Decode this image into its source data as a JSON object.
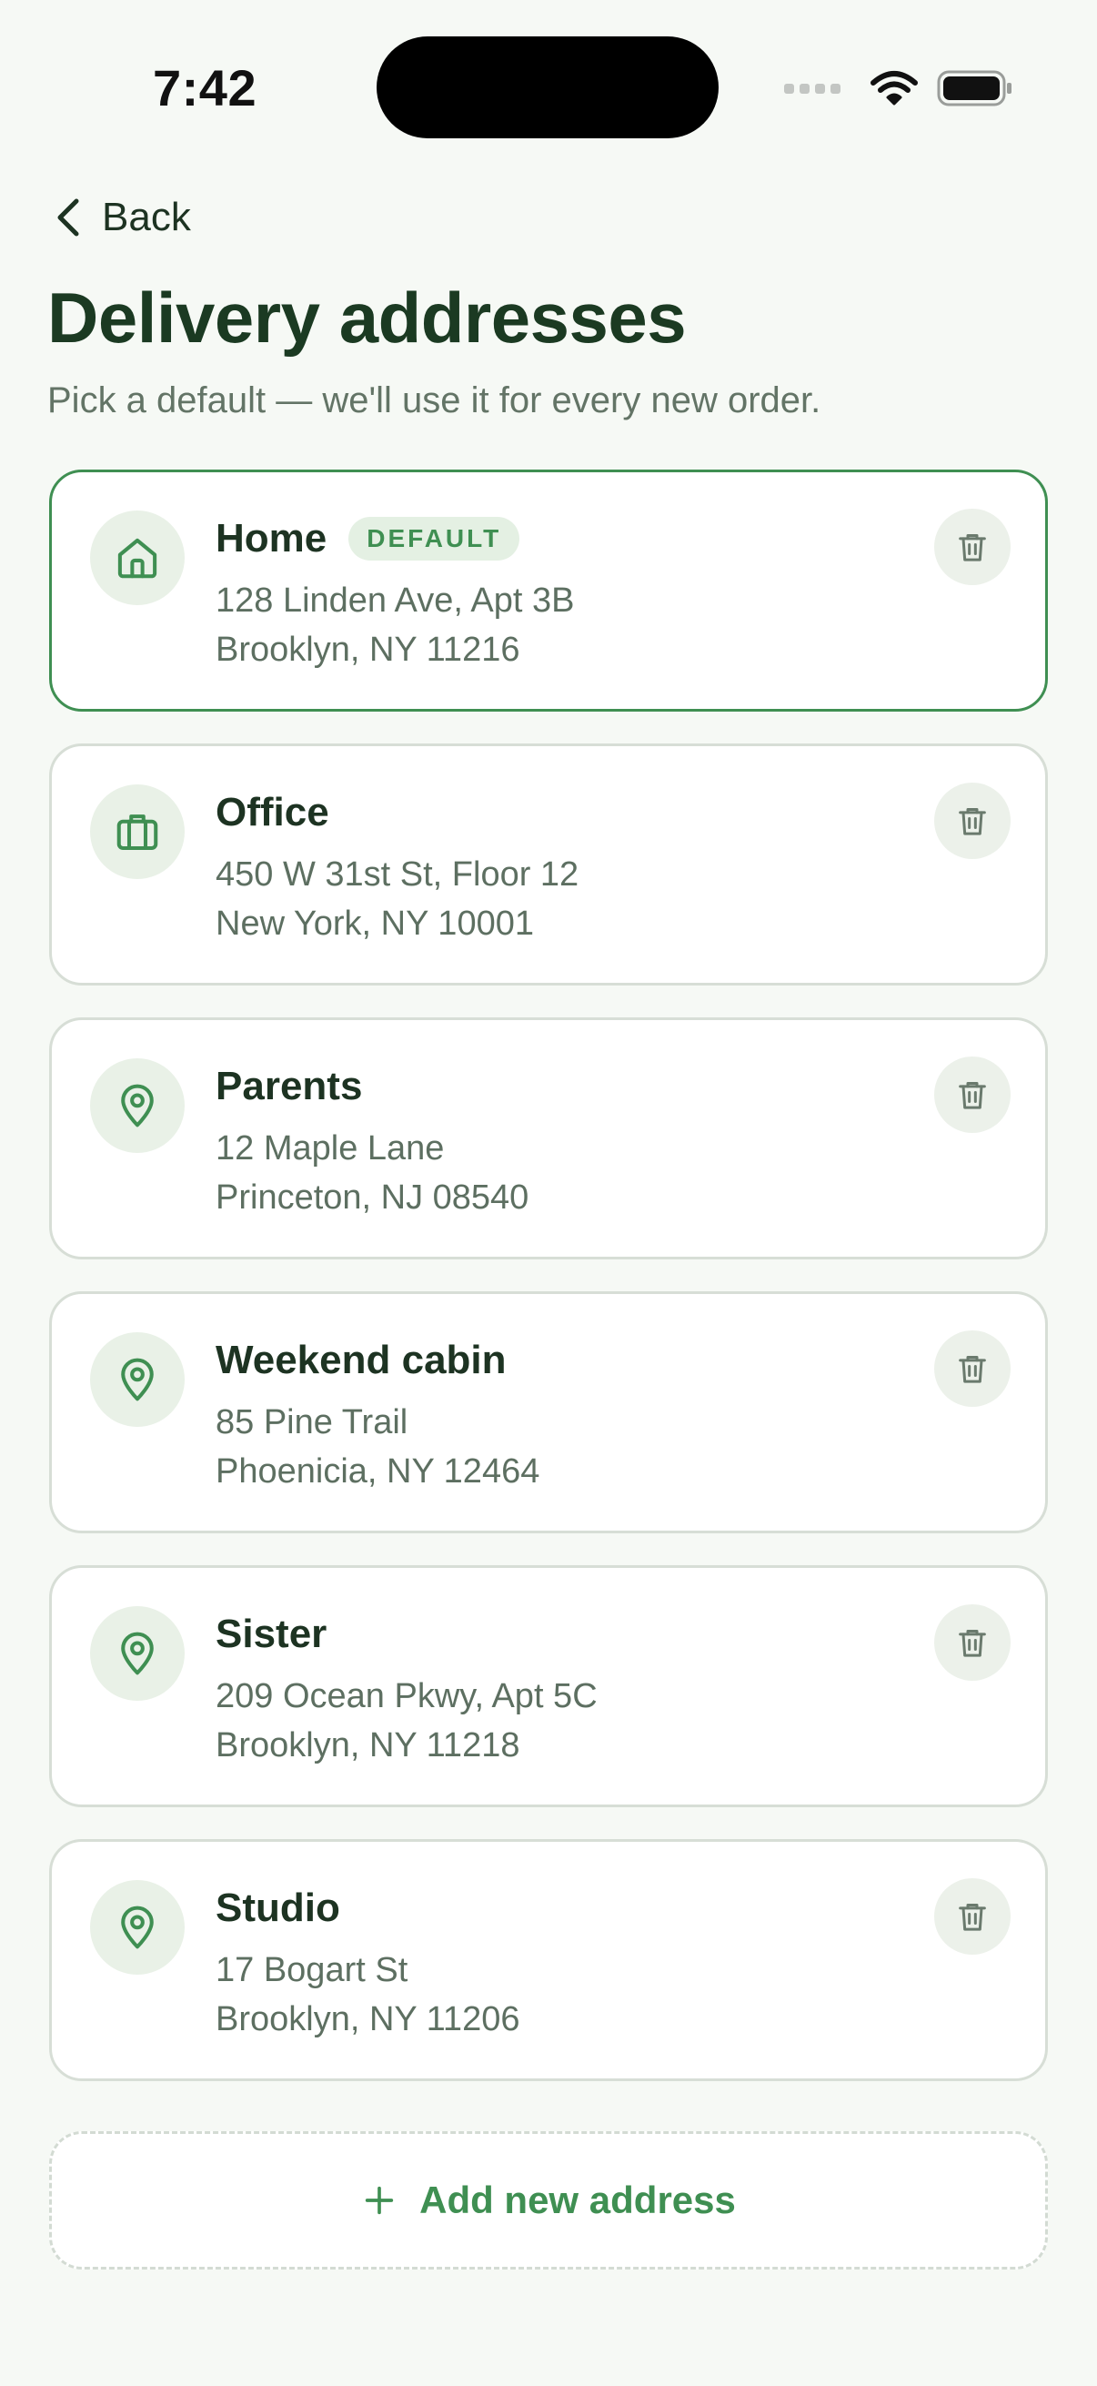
{
  "status_bar": {
    "time": "7:42"
  },
  "nav": {
    "back_label": "Back"
  },
  "header": {
    "title": "Delivery addresses",
    "subtitle": "Pick a default — we'll use it for every new order."
  },
  "colors": {
    "accent": "#3f8f52",
    "background": "#f6f9f5",
    "title": "#1b3a22"
  },
  "addresses": [
    {
      "name": "Home",
      "line1": "128 Linden Ave, Apt 3B",
      "line2": "Brooklyn, NY 11216",
      "icon": "home-icon",
      "default": true,
      "badge": "DEFAULT"
    },
    {
      "name": "Office",
      "line1": "450 W 31st St, Floor 12",
      "line2": "New York, NY 10001",
      "icon": "briefcase-icon",
      "default": false
    },
    {
      "name": "Parents",
      "line1": "12 Maple Lane",
      "line2": "Princeton, NJ 08540",
      "icon": "map-pin-icon",
      "default": false
    },
    {
      "name": "Weekend cabin",
      "line1": "85 Pine Trail",
      "line2": "Phoenicia, NY 12464",
      "icon": "map-pin-icon",
      "default": false
    },
    {
      "name": "Sister",
      "line1": "209 Ocean Pkwy, Apt 5C",
      "line2": "Brooklyn, NY 11218",
      "icon": "map-pin-icon",
      "default": false
    },
    {
      "name": "Studio",
      "line1": "17 Bogart St",
      "line2": "Brooklyn, NY 11206",
      "icon": "map-pin-icon",
      "default": false
    }
  ],
  "add_button": {
    "label": "Add new address",
    "icon": "plus-icon"
  },
  "icons": {
    "delete": "trash-icon",
    "back": "chevron-left-icon"
  }
}
